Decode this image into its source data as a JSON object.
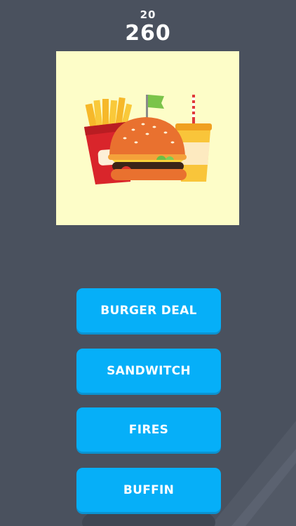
{
  "header": {
    "level": "20",
    "score": "260"
  },
  "puzzle": {
    "image": "burger-meal-illustration"
  },
  "answers": [
    {
      "label": "BURGER DEAL"
    },
    {
      "label": "SANDWITCH"
    },
    {
      "label": "FIRES"
    },
    {
      "label": "BUFFIN"
    }
  ],
  "colors": {
    "background": "#4a515e",
    "button": "#06aff8",
    "card": "#fdfdc8"
  }
}
